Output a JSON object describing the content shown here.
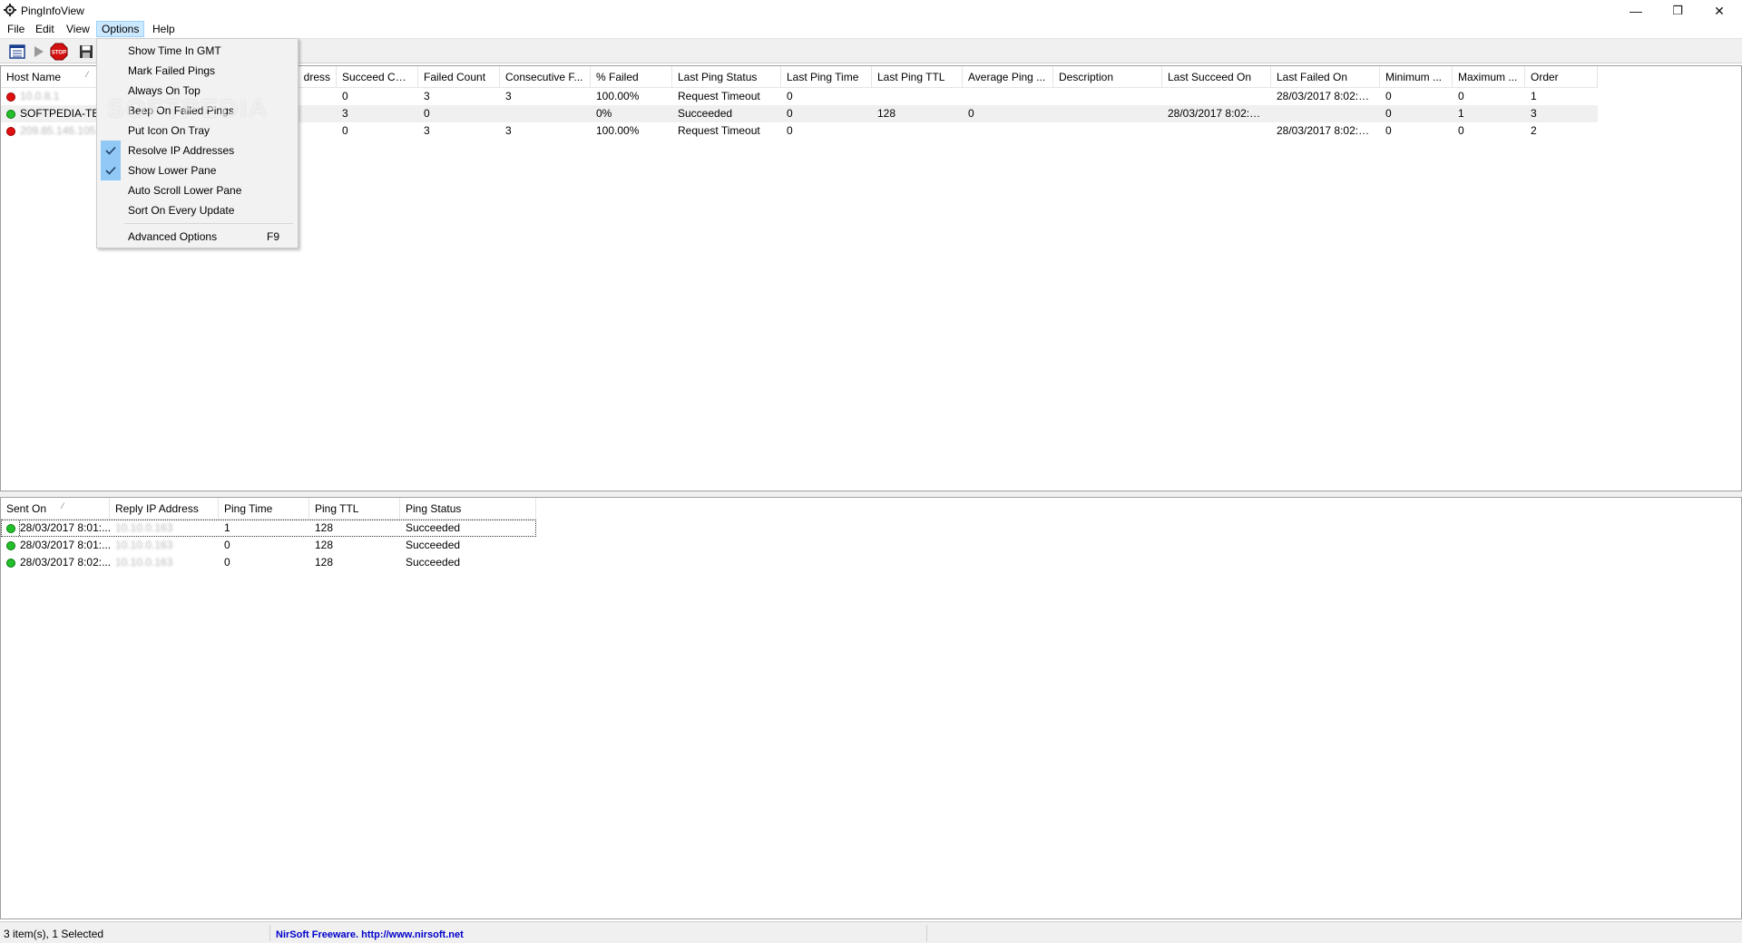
{
  "window": {
    "title": "PingInfoView",
    "icon": "gear-icon"
  },
  "window_controls": {
    "minimize": "—",
    "maximize": "❐",
    "close": "✕"
  },
  "menubar": {
    "items": [
      "File",
      "Edit",
      "View",
      "Options",
      "Help"
    ],
    "active": "Options"
  },
  "toolbar": {
    "buttons": [
      "properties-icon",
      "play-icon",
      "stop-icon",
      "save-icon"
    ],
    "stop_label": "STOP"
  },
  "options_menu": {
    "items": [
      {
        "label": "Show Time In GMT",
        "checked": false
      },
      {
        "label": "Mark Failed Pings",
        "checked": false
      },
      {
        "label": "Always On Top",
        "checked": false
      },
      {
        "label": "Beep On Failed Pings",
        "checked": false
      },
      {
        "label": "Put Icon On Tray",
        "checked": false
      },
      {
        "label": "Resolve IP Addresses",
        "checked": true
      },
      {
        "label": "Show Lower Pane",
        "checked": true
      },
      {
        "label": "Auto Scroll Lower Pane",
        "checked": false
      },
      {
        "label": "Sort On Every Update",
        "checked": false
      },
      {
        "label": "Advanced Options",
        "checked": false,
        "shortcut": "F9"
      }
    ]
  },
  "watermark": "SOFTPEDIA",
  "upper_table": {
    "columns": [
      "Host Name",
      "IP Address",
      "Succeed Cou...",
      "Failed Count",
      "Consecutive F...",
      "% Failed",
      "Last Ping Status",
      "Last Ping Time",
      "Last Ping TTL",
      "Average Ping ...",
      "Description",
      "Last Succeed On",
      "Last Failed On",
      "Minimum ...",
      "Maximum ...",
      "Order"
    ],
    "visible_ip_header_fragment": "dress",
    "rows": [
      {
        "status": "red",
        "host": "10.0.8.1",
        "ip": "",
        "succeed": "0",
        "failed": "3",
        "consecutive": "3",
        "pct_failed": "100.00%",
        "last_status": "Request Timeout",
        "last_time": "0",
        "last_ttl": "",
        "avg": "",
        "desc": "",
        "last_succeed": "",
        "last_failed": "28/03/2017 8:02:04...",
        "min": "0",
        "max": "0",
        "order": "1"
      },
      {
        "status": "green",
        "host": "SOFTPEDIA-TES",
        "ip": "",
        "succeed": "3",
        "failed": "0",
        "consecutive": "",
        "pct_failed": "0%",
        "last_status": "Succeeded",
        "last_time": "0",
        "last_ttl": "128",
        "avg": "0",
        "desc": "",
        "last_succeed": "28/03/2017 8:02:03...",
        "last_failed": "",
        "min": "0",
        "max": "1",
        "order": "3"
      },
      {
        "status": "red",
        "host": "209.85.146.105",
        "ip": "",
        "succeed": "0",
        "failed": "3",
        "consecutive": "3",
        "pct_failed": "100.00%",
        "last_status": "Request Timeout",
        "last_time": "0",
        "last_ttl": "",
        "avg": "",
        "desc": "",
        "last_succeed": "",
        "last_failed": "28/03/2017 8:02:04...",
        "min": "0",
        "max": "0",
        "order": "2"
      }
    ]
  },
  "lower_table": {
    "columns": [
      "Sent On",
      "Reply IP Address",
      "Ping Time",
      "Ping TTL",
      "Ping Status"
    ],
    "rows": [
      {
        "sent_on": "28/03/2017 8:01:...",
        "reply_ip": "10.10.0.163",
        "ping_time": "1",
        "ttl": "128",
        "status": "Succeeded"
      },
      {
        "sent_on": "28/03/2017 8:01:...",
        "reply_ip": "10.10.0.163",
        "ping_time": "0",
        "ttl": "128",
        "status": "Succeeded"
      },
      {
        "sent_on": "28/03/2017 8:02:...",
        "reply_ip": "10.10.0.163",
        "ping_time": "0",
        "ttl": "128",
        "status": "Succeeded"
      }
    ]
  },
  "statusbar": {
    "count": "3 item(s), 1 Selected",
    "credit": "NirSoft Freeware.  http://www.nirsoft.net"
  },
  "colors": {
    "menu_highlight": "#cce8ff",
    "check_bg": "#90c8f6",
    "link": "#0000cc",
    "red_status": "#e01010",
    "green_status": "#22c02a"
  }
}
